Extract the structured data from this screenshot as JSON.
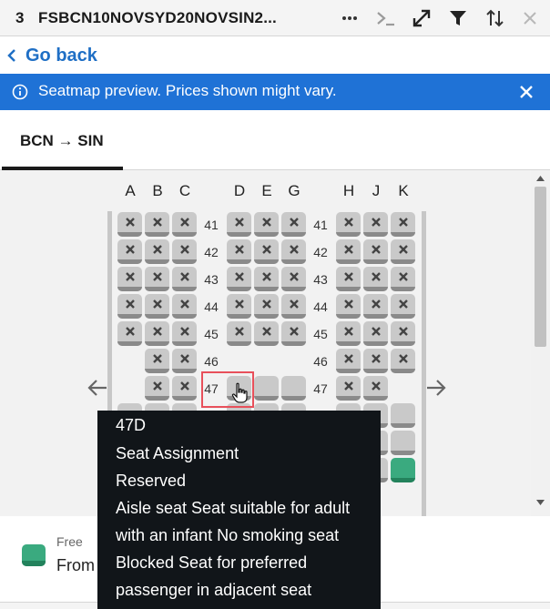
{
  "header": {
    "count": "3",
    "title": "FSBCN10NOVSYD20NOVSIN2...",
    "icons": [
      "ellipsis-icon",
      "terminal-icon",
      "expand-icon",
      "filter-icon",
      "sort-icon",
      "close-icon"
    ]
  },
  "nav": {
    "go_back": "Go back"
  },
  "banner": {
    "message": "Seatmap preview. Prices shown might vary."
  },
  "tabs": [
    {
      "label": "BCN → SIN",
      "active": true
    }
  ],
  "seatmap": {
    "columns": [
      "A",
      "B",
      "C",
      "D",
      "E",
      "G",
      "H",
      "J",
      "K"
    ],
    "rows": [
      "41",
      "42",
      "43",
      "44",
      "45",
      "46",
      "47"
    ]
  },
  "tooltip": {
    "seat": "47D",
    "lines": [
      "Seat Assignment",
      "Reserved",
      "Aisle seat Seat suitable for adult",
      "with an infant No smoking seat",
      "Blocked Seat for preferred",
      "passenger in adjacent seat"
    ]
  },
  "legend": {
    "free_label": "Free",
    "from_label": "From"
  },
  "colors": {
    "accent": "#1f72d6",
    "free_seat": "#3aaa7f",
    "highlight": "#e8505b"
  }
}
